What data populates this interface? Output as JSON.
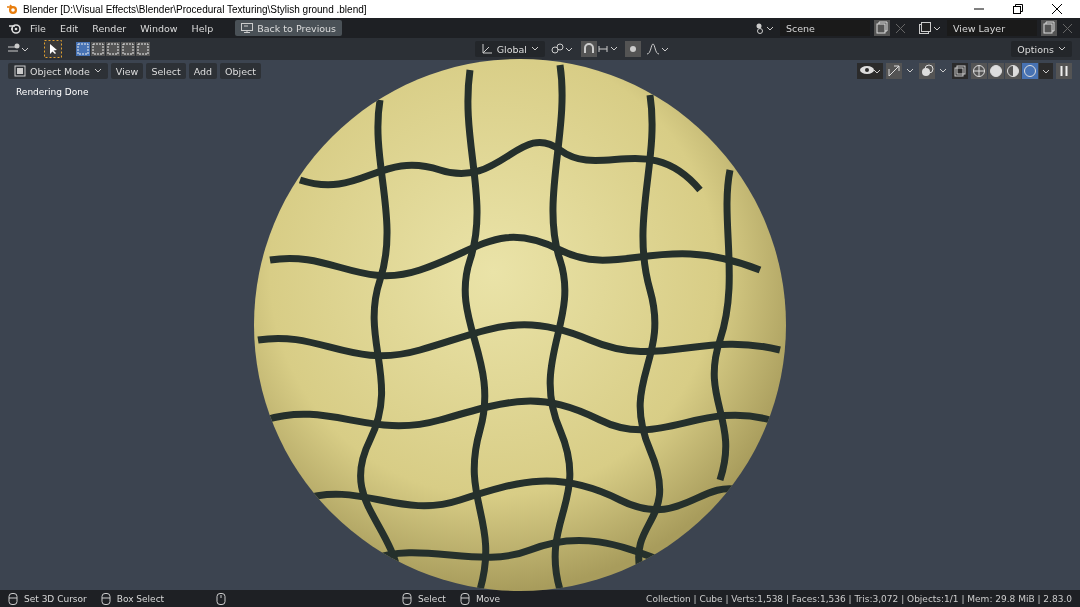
{
  "window": {
    "title": "Blender [D:\\Visual Effects\\Blender\\Procedural Texturing\\Stylish ground .blend]"
  },
  "menu": [
    "File",
    "Edit",
    "Render",
    "Window",
    "Help"
  ],
  "back_button": "Back to Previous",
  "scene": {
    "value": "Scene"
  },
  "view_layer": {
    "value": "View Layer"
  },
  "tool_header": {
    "orientation": "Global",
    "options": "Options",
    "select_modes": [
      {
        "selected": true
      },
      {
        "selected": false
      },
      {
        "selected": false
      },
      {
        "selected": false
      },
      {
        "selected": false
      }
    ]
  },
  "viewport_header": {
    "mode": "Object Mode",
    "menus": [
      "View",
      "Select",
      "Add",
      "Object"
    ],
    "shading_modes": [
      {
        "selected": false
      },
      {
        "selected": false
      },
      {
        "selected": false
      },
      {
        "selected": true
      }
    ]
  },
  "viewport": {
    "status": "Rendering Done"
  },
  "status_bar": {
    "left_hints": [
      "Set 3D Cursor",
      "Box Select"
    ],
    "right_hints": [
      "Select",
      "Move"
    ],
    "stats": "Collection | Cube | Verts:1,538 | Faces:1,536 | Tris:3,072 | Objects:1/1 | Mem: 29.8 MiB | 2.83.0"
  }
}
